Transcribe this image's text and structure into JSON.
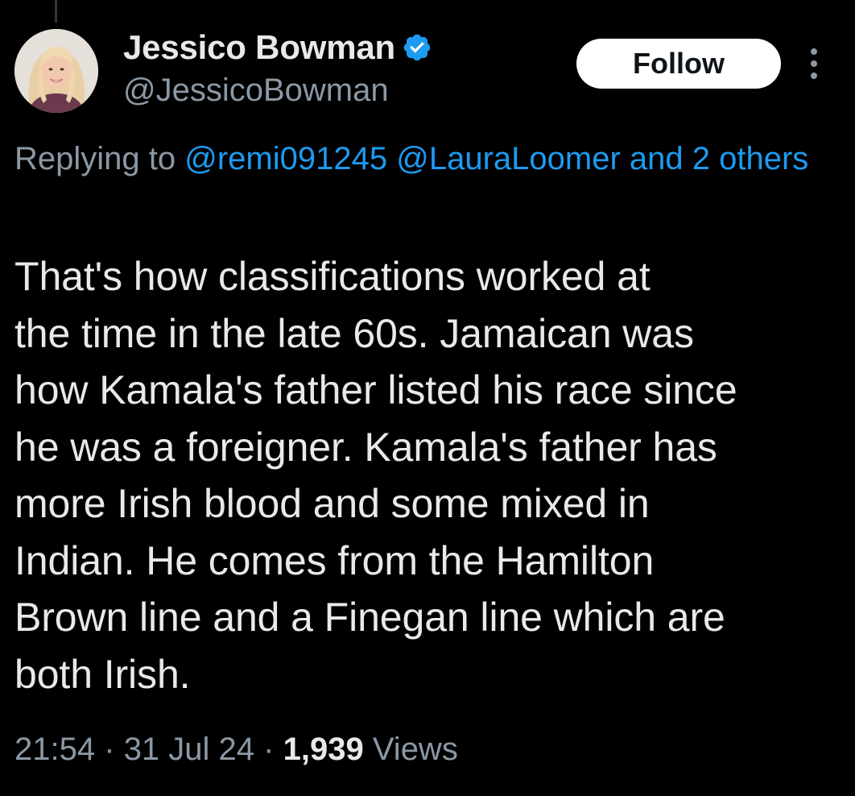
{
  "author": {
    "display_name": "Jessico Bowman",
    "handle": "@JessicoBowman",
    "verified": true,
    "avatar_icon": "profile-photo"
  },
  "actions": {
    "follow_label": "Follow",
    "more_icon": "more-vertical-icon"
  },
  "reply_context": {
    "prefix": "Replying to",
    "mentions": [
      "@remi091245",
      "@LauraLoomer"
    ],
    "others_link": "and 2 others"
  },
  "tweet": {
    "text_lines": [
      "That's how classifications worked at",
      "the time in the late 60s. Jamaican was",
      "how Kamala's father listed his race since",
      "he was a foreigner. Kamala's father has",
      "more Irish blood and some mixed in",
      "Indian. He comes from the Hamilton",
      "Brown line and a Finegan line which are",
      "both Irish."
    ]
  },
  "meta": {
    "time": "21:54",
    "separator": "·",
    "date": "31 Jul 24",
    "views_count": "1,939",
    "views_label": "Views"
  },
  "colors": {
    "background": "#000000",
    "primary_text": "#e7e9ea",
    "secondary_text": "#8b98a5",
    "accent": "#1d9bf0",
    "follow_bg": "#ffffff"
  }
}
